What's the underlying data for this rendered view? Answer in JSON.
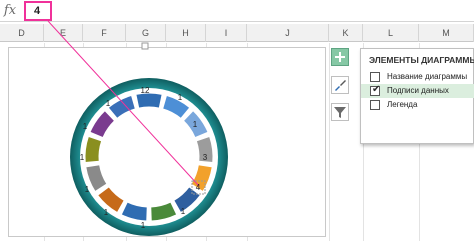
{
  "formula_bar": {
    "fx_label": "fx",
    "value": "4"
  },
  "columns": [
    "D",
    "E",
    "F",
    "G",
    "H",
    "I",
    "J",
    "K",
    "L",
    "M"
  ],
  "chart": {
    "segment_labels": [
      "1",
      "12",
      "1",
      "1",
      "3",
      "4",
      "1",
      "1",
      "1",
      "1",
      "1",
      "1",
      "1"
    ]
  },
  "chart_elements": {
    "title": "ЭЛЕМЕНТЫ ДИАГРАММЫ",
    "items": [
      {
        "label": "Название диаграммы",
        "checked": false
      },
      {
        "label": "Подписи данных",
        "checked": true
      },
      {
        "label": "Легенда",
        "checked": false
      }
    ]
  },
  "colors": {
    "accent_pink": "#f0319a",
    "button_green": "#86c8a5",
    "ring_teal": "#1e8b8e",
    "selected_orange": "#f2a12b"
  },
  "icons": {
    "plus": "plus-icon",
    "brush": "brush-icon",
    "filter": "filter-icon"
  }
}
